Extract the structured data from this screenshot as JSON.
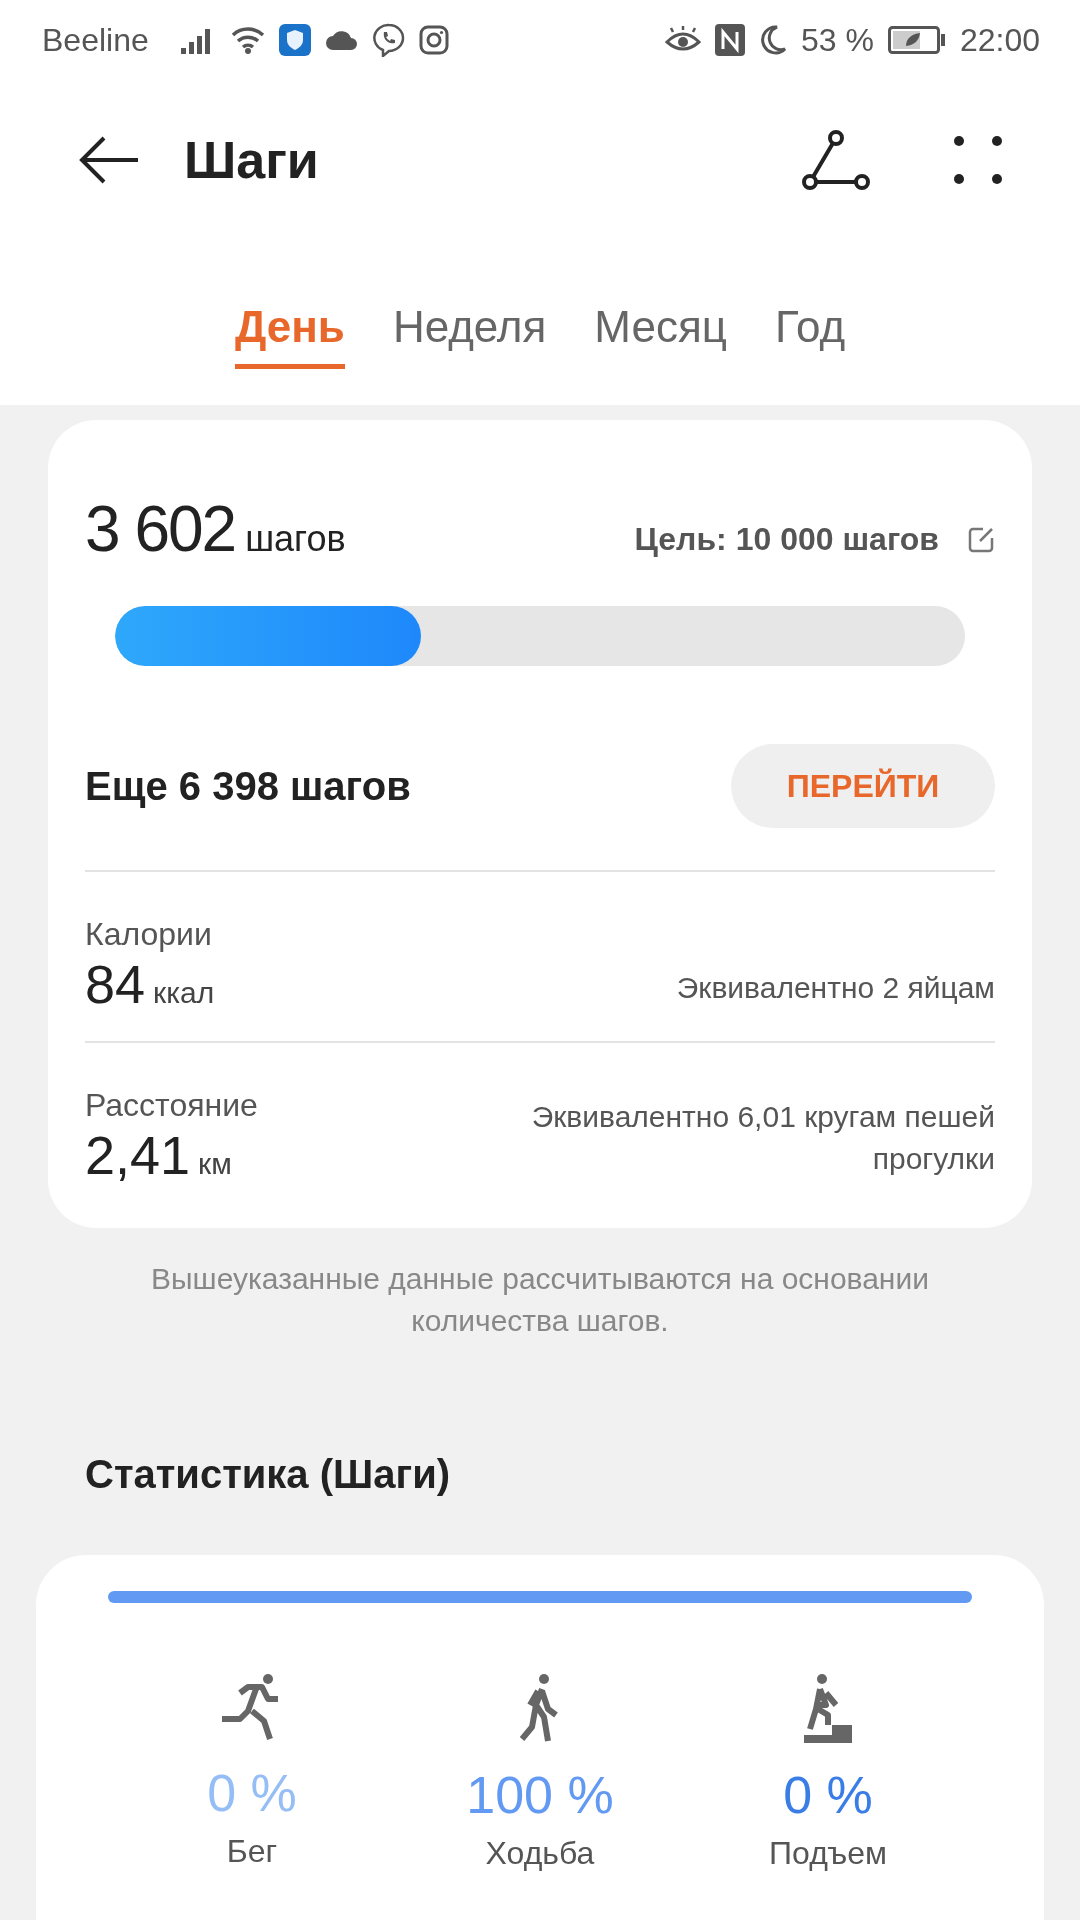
{
  "status_bar": {
    "carrier": "Beeline",
    "battery_percent": "53 %",
    "time": "22:00"
  },
  "header": {
    "title": "Шаги"
  },
  "tabs": [
    {
      "label": "День",
      "selected": true
    },
    {
      "label": "Неделя",
      "selected": false
    },
    {
      "label": "Месяц",
      "selected": false
    },
    {
      "label": "Год",
      "selected": false
    }
  ],
  "summary": {
    "steps": "3 602",
    "steps_unit": "шагов",
    "goal": "Цель: 10 000 шагов",
    "level": 0.36,
    "remaining": "Еще 6 398 шагов",
    "go_button": "ПЕРЕЙТИ",
    "metrics": [
      {
        "label": "Калории",
        "value": "84",
        "unit": "ккал",
        "equivalent": "Эквивалентно 2 яйцам"
      },
      {
        "label": "Расстояние",
        "value": "2,41",
        "unit": "км",
        "equivalent": "Эквивалентно 6,01 кругам пешей прогулки"
      }
    ]
  },
  "note": "Вышеуказанные данные рассчитываются на основании количества шагов.",
  "statistics": {
    "title": "Статистика (Шаги)",
    "activities": [
      {
        "kind": "run",
        "percent": "0 %",
        "label": "Бег",
        "color": "#94bef5"
      },
      {
        "kind": "walk",
        "percent": "100 %",
        "label": "Ходьба",
        "color": "#6299f2"
      },
      {
        "kind": "climb",
        "percent": "0 %",
        "label": "Подъем",
        "color": "#3a7de6"
      }
    ]
  }
}
